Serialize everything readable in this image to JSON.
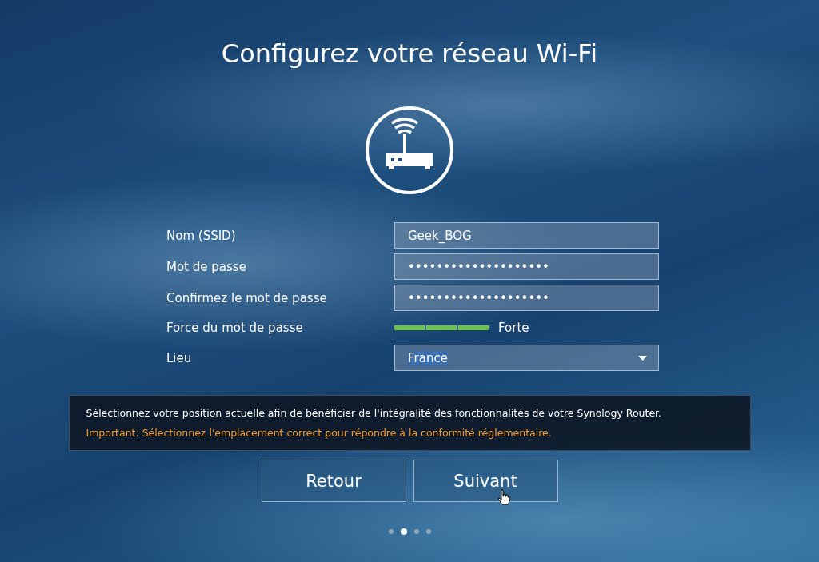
{
  "title": "Configurez votre réseau Wi-Fi",
  "form": {
    "fields": [
      {
        "kind": "text",
        "label": "Nom (SSID)",
        "value": "Geek_BOG"
      },
      {
        "kind": "text",
        "label": "Mot de passe",
        "value": "••••••••••••••••••••"
      },
      {
        "kind": "text",
        "label": "Confirmez le mot de passe",
        "value": "••••••••••••••••••••"
      },
      {
        "kind": "meter",
        "label": "Force du mot de passe",
        "level": 1,
        "reading": "Forte"
      },
      {
        "kind": "select",
        "label": "Lieu",
        "value": "France",
        "text_selected": true
      }
    ]
  },
  "notice": {
    "message": "Sélectionnez votre position actuelle afin de bénéficier de l'intégralité des fonctionnalités de votre Synology Router.",
    "warning": "Important: Sélectionnez l'emplacement correct pour répondre à la conformité réglementaire."
  },
  "buttons": [
    "Retour",
    "Suivant"
  ],
  "pager": [
    {
      "selected": false
    },
    {
      "selected": true
    },
    {
      "selected": false
    },
    {
      "selected": false
    }
  ]
}
